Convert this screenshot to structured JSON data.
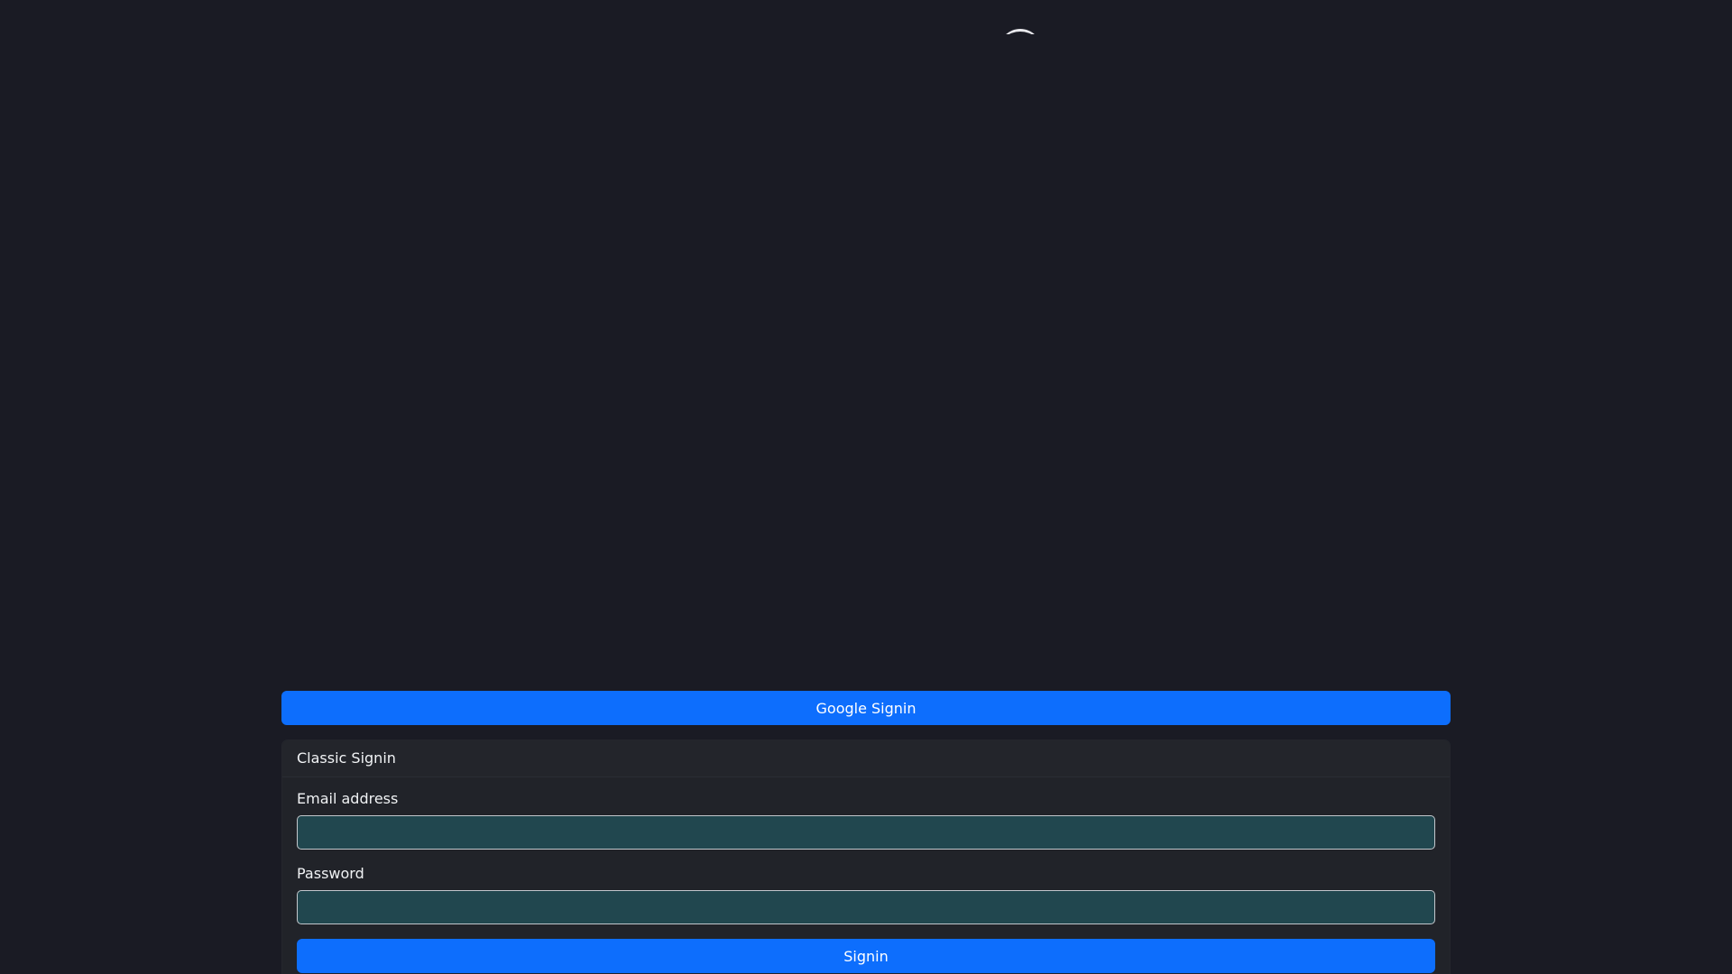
{
  "logo": {
    "icon": "logo-arc-icon",
    "color": "#e8e8ec"
  },
  "google_signin": {
    "label": "Google Signin"
  },
  "classic_signin": {
    "title": "Classic Signin",
    "email": {
      "label": "Email address",
      "value": "",
      "placeholder": ""
    },
    "password": {
      "label": "Password",
      "value": "",
      "placeholder": ""
    },
    "submit_label": "Signin"
  },
  "colors": {
    "background": "#1a1b24",
    "primary": "#0d6efd",
    "card": "#212329",
    "input": "#21474f"
  }
}
